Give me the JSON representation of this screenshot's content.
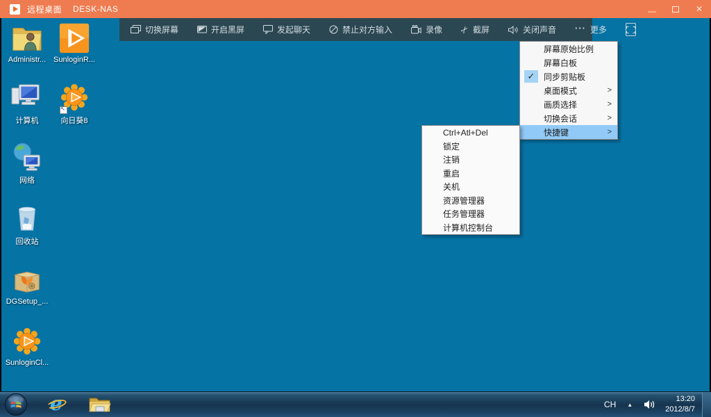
{
  "window": {
    "app_title": "远程桌面",
    "host_name": "DESK-NAS",
    "minimize_glyph": "—",
    "close_glyph": "✕"
  },
  "toolbar": {
    "buttons": [
      {
        "label": "切换屏幕"
      },
      {
        "label": "开启黑屏"
      },
      {
        "label": "发起聊天"
      },
      {
        "label": "禁止对方输入"
      },
      {
        "label": "录像"
      },
      {
        "label": "截屏"
      },
      {
        "label": "关闭声音"
      },
      {
        "label": "更多",
        "prefix": "···"
      }
    ],
    "scissors_glyph": "✂"
  },
  "desktop": {
    "icons": [
      {
        "label": "Administr...",
        "type": "user-folder"
      },
      {
        "label": "SunloginR...",
        "type": "sunlogin-square"
      },
      {
        "label": "计算机",
        "type": "computer"
      },
      {
        "label": "向日葵8",
        "type": "sunflower-shortcut"
      },
      {
        "label": "网络",
        "type": "network"
      },
      {
        "label": "回收站",
        "type": "recycle-bin"
      },
      {
        "label": "DGSetup_...",
        "type": "package-box"
      },
      {
        "label": "SunloginCl...",
        "type": "sunflower"
      }
    ]
  },
  "more_menu": {
    "check_glyph": "✓",
    "items": [
      {
        "label": "屏幕原始比例"
      },
      {
        "label": "屏幕白板"
      },
      {
        "label": "同步剪贴板",
        "checked": true
      },
      {
        "label": "桌面模式",
        "arrow": ">"
      },
      {
        "label": "画质选择",
        "arrow": ">"
      },
      {
        "label": "切换会话",
        "arrow": ">"
      },
      {
        "label": "快捷键",
        "arrow": ">",
        "highlighted": true
      }
    ]
  },
  "shortcut_menu": {
    "items": [
      {
        "label": "Ctrl+Atl+Del"
      },
      {
        "label": "锁定"
      },
      {
        "label": "注销"
      },
      {
        "label": "重启"
      },
      {
        "label": "关机"
      },
      {
        "label": "资源管理器"
      },
      {
        "label": "任务管理器"
      },
      {
        "label": "计算机控制台"
      }
    ]
  },
  "taskbar": {
    "language_indicator": "CH",
    "hidden_icons_glyph": "▲",
    "ie_glyph": "e",
    "clock": {
      "time": "13:20",
      "date": "2012/8/7"
    }
  },
  "colors": {
    "titlebar": "#ef7c50",
    "toolbar": "#2b4752",
    "desktop": "#0673a5",
    "menu_highlight": "#91c9f7",
    "check_background": "#a5d3f3"
  }
}
